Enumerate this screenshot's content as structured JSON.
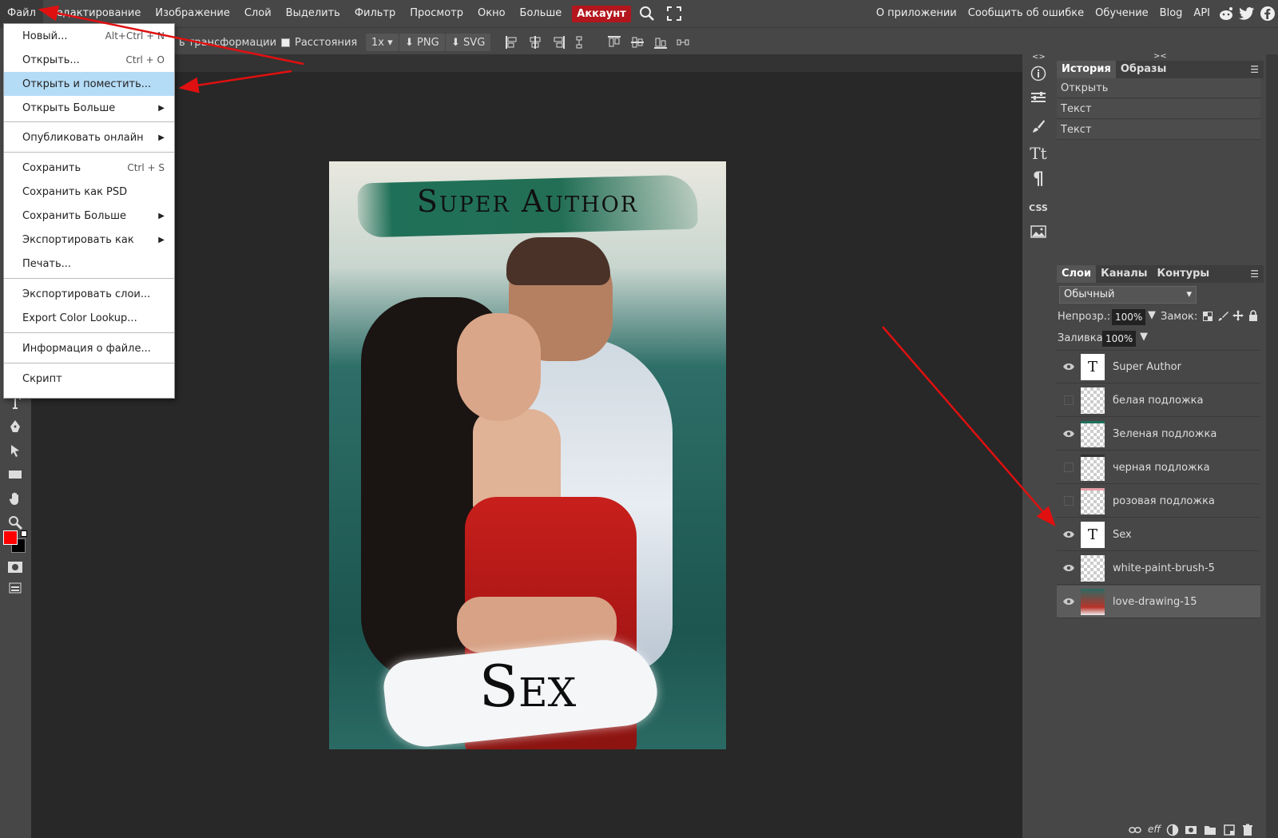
{
  "menubar": {
    "items": [
      "Файл",
      "Редактирование",
      "Изображение",
      "Слой",
      "Выделить",
      "Фильтр",
      "Просмотр",
      "Окно",
      "Больше"
    ],
    "account": "Аккаунт",
    "right_items": [
      "О приложении",
      "Сообщить об ошибке",
      "Обучение",
      "Blog",
      "API"
    ],
    "icons": [
      "search-icon",
      "fullscreen-icon",
      "reddit-icon",
      "twitter-icon",
      "facebook-icon"
    ]
  },
  "options": {
    "transform_label": "ь трансформации",
    "distances_label": "Расстояния",
    "scale": "1x",
    "png": "PNG",
    "svg": "SVG"
  },
  "file_menu": {
    "items": [
      {
        "label": "Новый...",
        "shortcut": "Alt+Ctrl + N"
      },
      {
        "label": "Открыть...",
        "shortcut": "Ctrl + O"
      },
      {
        "label": "Открыть и поместить...",
        "shortcut": ""
      },
      {
        "label": "Открыть Больше",
        "shortcut": ""
      },
      {
        "label": "Опубликовать онлайн",
        "shortcut": ""
      },
      {
        "label": "Сохранить",
        "shortcut": "Ctrl + S"
      },
      {
        "label": "Сохранить как PSD",
        "shortcut": ""
      },
      {
        "label": "Сохранить Больше",
        "shortcut": ""
      },
      {
        "label": "Экспортировать как",
        "shortcut": ""
      },
      {
        "label": "Печать...",
        "shortcut": ""
      },
      {
        "label": "Экспортировать слои...",
        "shortcut": ""
      },
      {
        "label": "Export Color Lookup...",
        "shortcut": ""
      },
      {
        "label": "Информация о файле...",
        "shortcut": ""
      },
      {
        "label": "Скрипт",
        "shortcut": ""
      }
    ],
    "highlighted": "Открыть и поместить..."
  },
  "canvas": {
    "top_text": "Super Author",
    "bottom_text": "Sex"
  },
  "history_panel": {
    "tabs": [
      "История",
      "Образы"
    ],
    "items": [
      "Открыть",
      "Текст",
      "Текст"
    ]
  },
  "layers_panel": {
    "tabs": [
      "Слои",
      "Каналы",
      "Контуры"
    ],
    "blend_mode": "Обычный",
    "opacity_label": "Непрозр.:",
    "opacity_value": "100%",
    "lock_label": "Замок:",
    "fill_label": "Заливка:",
    "fill_value": "100%",
    "layers": [
      {
        "name": "Super Author",
        "visible": true,
        "type": "text"
      },
      {
        "name": "белая подложка",
        "visible": false,
        "type": "raster"
      },
      {
        "name": "Зеленая подложка",
        "visible": true,
        "type": "raster"
      },
      {
        "name": "черная подложка",
        "visible": false,
        "type": "raster"
      },
      {
        "name": "розовая подложка",
        "visible": false,
        "type": "raster"
      },
      {
        "name": "Sex",
        "visible": true,
        "type": "text"
      },
      {
        "name": "white-paint-brush-5",
        "visible": true,
        "type": "raster"
      },
      {
        "name": "love-drawing-15",
        "visible": true,
        "type": "image"
      }
    ],
    "selected": "love-drawing-15"
  },
  "right_strip": {
    "css_label": "CSS",
    "top_arrows": "<>",
    "panel_arrows": "><"
  },
  "colors": {
    "accent_account": "#b3161c",
    "foreground": "#ff0000",
    "background": "#000000",
    "highlight": "#b5dcf7",
    "annotation": "#e01010"
  }
}
